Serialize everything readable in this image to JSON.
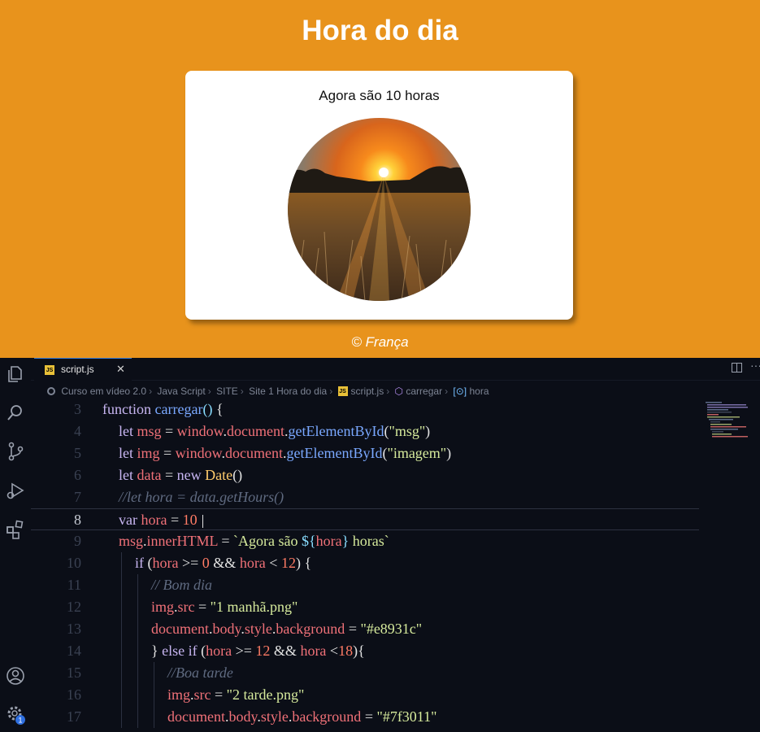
{
  "webpage": {
    "title": "Hora do dia",
    "message": "Agora são 10 horas",
    "footer": "© França",
    "background_color": "#e8931c"
  },
  "editor": {
    "tab": {
      "label": "script.js",
      "close": "✕",
      "badge": "JS"
    },
    "breadcrumbs": [
      "Curso em vídeo 2.0",
      "Java Script",
      "SITE",
      "Site 1 Hora do dia",
      "script.js",
      "carregar",
      "hora"
    ],
    "settings_badge": "1",
    "active_line": 8,
    "lines": [
      {
        "n": "3",
        "indent": 0,
        "tokens": [
          [
            "kw",
            "function "
          ],
          [
            "fn",
            "carregar"
          ],
          [
            "punc",
            "() "
          ],
          [
            "pl",
            "{"
          ]
        ]
      },
      {
        "n": "4",
        "indent": 1,
        "tokens": [
          [
            "kw",
            "let "
          ],
          [
            "var",
            "msg"
          ],
          [
            "pl",
            " = "
          ],
          [
            "var",
            "window"
          ],
          [
            "pl",
            "."
          ],
          [
            "var",
            "document"
          ],
          [
            "pl",
            "."
          ],
          [
            "fn",
            "getElementById"
          ],
          [
            "pl",
            "("
          ],
          [
            "str",
            "\"msg\""
          ],
          [
            "pl",
            ")"
          ]
        ]
      },
      {
        "n": "5",
        "indent": 1,
        "tokens": [
          [
            "kw",
            "let "
          ],
          [
            "var",
            "img"
          ],
          [
            "pl",
            " = "
          ],
          [
            "var",
            "window"
          ],
          [
            "pl",
            "."
          ],
          [
            "var",
            "document"
          ],
          [
            "pl",
            "."
          ],
          [
            "fn",
            "getElementById"
          ],
          [
            "pl",
            "("
          ],
          [
            "str",
            "\"imagem\""
          ],
          [
            "pl",
            ")"
          ]
        ]
      },
      {
        "n": "6",
        "indent": 1,
        "tokens": [
          [
            "kw",
            "let "
          ],
          [
            "var",
            "data"
          ],
          [
            "pl",
            " = "
          ],
          [
            "kw",
            "new "
          ],
          [
            "cls",
            "Date"
          ],
          [
            "pl",
            "()"
          ]
        ]
      },
      {
        "n": "7",
        "indent": 1,
        "tokens": [
          [
            "com",
            "//let hora = data.getHours()"
          ]
        ]
      },
      {
        "n": "8",
        "indent": 1,
        "tokens": [
          [
            "kw",
            "var "
          ],
          [
            "var",
            "hora"
          ],
          [
            "pl",
            " = "
          ],
          [
            "num",
            "10"
          ]
        ]
      },
      {
        "n": "9",
        "indent": 1,
        "tokens": [
          [
            "var",
            "msg"
          ],
          [
            "pl",
            "."
          ],
          [
            "var",
            "innerHTML"
          ],
          [
            "pl",
            " = "
          ],
          [
            "str",
            "`Agora são "
          ],
          [
            "punc",
            "${"
          ],
          [
            "var",
            "hora"
          ],
          [
            "punc",
            "}"
          ],
          [
            "str",
            " horas`"
          ]
        ]
      },
      {
        "n": "10",
        "indent": 2,
        "tokens": [
          [
            "kw",
            "if "
          ],
          [
            "pl",
            "("
          ],
          [
            "var",
            "hora"
          ],
          [
            "pl",
            " >= "
          ],
          [
            "num",
            "0"
          ],
          [
            "pl",
            " && "
          ],
          [
            "var",
            "hora"
          ],
          [
            "pl",
            " < "
          ],
          [
            "num",
            "12"
          ],
          [
            "pl",
            ") {"
          ]
        ]
      },
      {
        "n": "11",
        "indent": 3,
        "tokens": [
          [
            "com",
            "// Bom dia"
          ]
        ]
      },
      {
        "n": "12",
        "indent": 3,
        "tokens": [
          [
            "var",
            "img"
          ],
          [
            "pl",
            "."
          ],
          [
            "var",
            "src"
          ],
          [
            "pl",
            " = "
          ],
          [
            "str",
            "\"1 manhã.png\""
          ]
        ]
      },
      {
        "n": "13",
        "indent": 3,
        "tokens": [
          [
            "var",
            "document"
          ],
          [
            "pl",
            "."
          ],
          [
            "var",
            "body"
          ],
          [
            "pl",
            "."
          ],
          [
            "var",
            "style"
          ],
          [
            "pl",
            "."
          ],
          [
            "var",
            "background"
          ],
          [
            "pl",
            " = "
          ],
          [
            "str",
            "\"#e8931c\""
          ]
        ]
      },
      {
        "n": "14",
        "indent": 3,
        "tokens": [
          [
            "pl",
            "} "
          ],
          [
            "kw",
            "else if "
          ],
          [
            "pl",
            "("
          ],
          [
            "var",
            "hora"
          ],
          [
            "pl",
            " >= "
          ],
          [
            "num",
            "12"
          ],
          [
            "pl",
            " && "
          ],
          [
            "var",
            "hora"
          ],
          [
            "pl",
            " <"
          ],
          [
            "num",
            "18"
          ],
          [
            "pl",
            "){"
          ]
        ]
      },
      {
        "n": "15",
        "indent": 4,
        "tokens": [
          [
            "com",
            "//Boa tarde"
          ]
        ]
      },
      {
        "n": "16",
        "indent": 4,
        "tokens": [
          [
            "var",
            "img"
          ],
          [
            "pl",
            "."
          ],
          [
            "var",
            "src"
          ],
          [
            "pl",
            " = "
          ],
          [
            "str",
            "\"2 tarde.png\""
          ]
        ]
      },
      {
        "n": "17",
        "indent": 4,
        "tokens": [
          [
            "var",
            "document"
          ],
          [
            "pl",
            "."
          ],
          [
            "var",
            "body"
          ],
          [
            "pl",
            "."
          ],
          [
            "var",
            "style"
          ],
          [
            "pl",
            "."
          ],
          [
            "var",
            "background"
          ],
          [
            "pl",
            " = "
          ],
          [
            "str",
            "\"#7f3011\""
          ]
        ]
      }
    ]
  }
}
